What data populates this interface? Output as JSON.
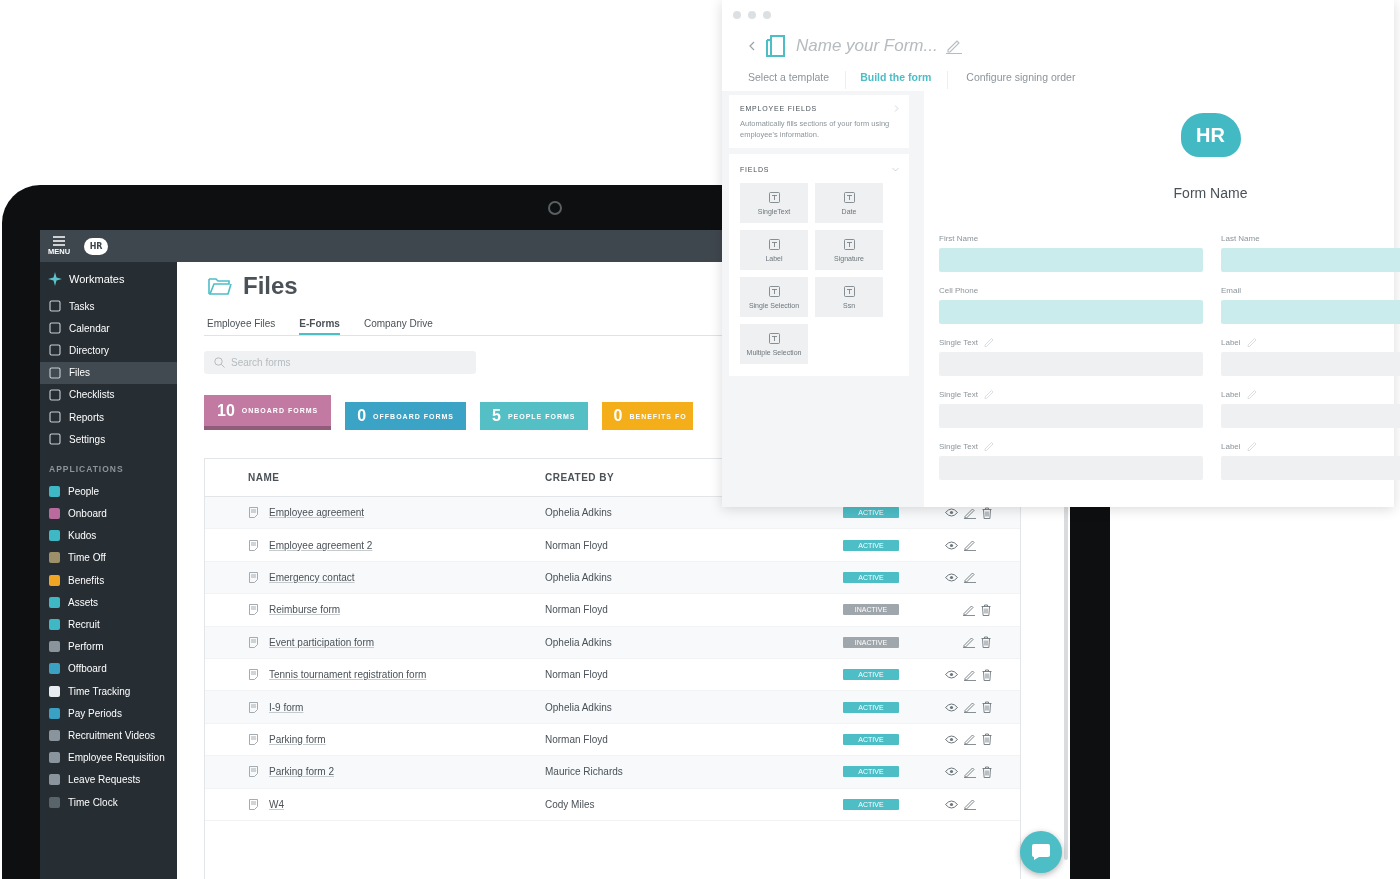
{
  "app": {
    "menu_label": "MENU",
    "logo": "HR"
  },
  "sidebar": {
    "brand": "Workmates",
    "items": [
      {
        "label": "Tasks",
        "selected": false
      },
      {
        "label": "Calendar",
        "selected": false
      },
      {
        "label": "Directory",
        "selected": false
      },
      {
        "label": "Files",
        "selected": true
      },
      {
        "label": "Checklists",
        "selected": false
      },
      {
        "label": "Reports",
        "selected": false
      },
      {
        "label": "Settings",
        "selected": false
      }
    ],
    "section": "APPLICATIONS",
    "apps": [
      {
        "label": "People",
        "color": "#3fb8c6"
      },
      {
        "label": "Onboard",
        "color": "#b86b9c"
      },
      {
        "label": "Kudos",
        "color": "#3fb8c6"
      },
      {
        "label": "Time Off",
        "color": "#9c8f6a"
      },
      {
        "label": "Benefits",
        "color": "#f0a623"
      },
      {
        "label": "Assets",
        "color": "#3fb8c6"
      },
      {
        "label": "Recruit",
        "color": "#3fb8c6"
      },
      {
        "label": "Perform",
        "color": "#8a949c"
      },
      {
        "label": "Offboard",
        "color": "#3aa0c4"
      },
      {
        "label": "Time Tracking",
        "color": "#e8eef0"
      },
      {
        "label": "Pay Periods",
        "color": "#3aa0c4"
      },
      {
        "label": "Recruitment Videos",
        "color": "#8a949c"
      },
      {
        "label": "Employee Requisition",
        "color": "#8a949c"
      },
      {
        "label": "Leave Requests",
        "color": "#8a949c"
      },
      {
        "label": "Time Clock",
        "color": "#59636a"
      }
    ]
  },
  "page": {
    "title": "Files",
    "tabs": [
      {
        "label": "Employee Files",
        "selected": false
      },
      {
        "label": "E-Forms",
        "selected": true
      },
      {
        "label": "Company Drive",
        "selected": false
      }
    ],
    "search": {
      "placeholder": "Search forms"
    },
    "cards": [
      {
        "count": "10",
        "label": "ONBOARD FORMS",
        "color": "#c27aa3",
        "selected": true
      },
      {
        "count": "0",
        "label": "OFFBOARD FORMS",
        "color": "#3aa3c6",
        "selected": false
      },
      {
        "count": "5",
        "label": "PEOPLE FORMS",
        "color": "#55bfc6",
        "selected": false
      },
      {
        "count": "0",
        "label": "BENEFITS FO",
        "color": "#f3ae19",
        "selected": false
      }
    ],
    "table": {
      "columns": [
        "NAME",
        "CREATED BY"
      ],
      "rows": [
        {
          "name": "Employee agreement",
          "created_by": "Ophelia Adkins",
          "status": "ACTIVE",
          "active": true,
          "view": true,
          "delete": true
        },
        {
          "name": "Employee agreement 2",
          "created_by": "Norman Floyd",
          "status": "ACTIVE",
          "active": true,
          "view": true,
          "delete": false
        },
        {
          "name": "Emergency contact",
          "created_by": "Ophelia Adkins",
          "status": "ACTIVE",
          "active": true,
          "view": true,
          "delete": false
        },
        {
          "name": "Reimburse form",
          "created_by": "Norman Floyd",
          "status": "INACTIVE",
          "active": false,
          "view": false,
          "delete": true
        },
        {
          "name": "Event participation form",
          "created_by": "Ophelia Adkins",
          "status": "INACTIVE",
          "active": false,
          "view": false,
          "delete": true
        },
        {
          "name": "Tennis tournament registration form",
          "created_by": "Norman Floyd",
          "status": "ACTIVE",
          "active": true,
          "view": true,
          "delete": true
        },
        {
          "name": "I-9 form",
          "created_by": "Ophelia Adkins",
          "status": "ACTIVE",
          "active": true,
          "view": true,
          "delete": true
        },
        {
          "name": "Parking form",
          "created_by": "Norman Floyd",
          "status": "ACTIVE",
          "active": true,
          "view": true,
          "delete": true
        },
        {
          "name": "Parking form 2",
          "created_by": "Maurice Richards",
          "status": "ACTIVE",
          "active": true,
          "view": true,
          "delete": true
        },
        {
          "name": "W4",
          "created_by": "Cody Miles",
          "status": "ACTIVE",
          "active": true,
          "view": true,
          "delete": false
        }
      ]
    }
  },
  "builder": {
    "title": {
      "placeholder": "Name your Form..."
    },
    "steps": [
      {
        "label": "Select a template",
        "selected": false
      },
      {
        "label": "Build the form",
        "selected": true
      },
      {
        "label": "Configure signing order",
        "selected": false
      }
    ],
    "employee_fields": {
      "title": "EMPLOYEE FIELDS",
      "description": "Automatically fills sections of your form using employee's information."
    },
    "fields": {
      "title": "FIELDS",
      "items": [
        "SingleText",
        "Date",
        "Label",
        "Signature",
        "Single Selection",
        "Ssn",
        "Multiple Selection"
      ]
    },
    "form": {
      "logo": "HR",
      "name": "Form Name",
      "fields": [
        {
          "label": "First Name",
          "kind": "employee"
        },
        {
          "label": "Last Name",
          "kind": "employee"
        },
        {
          "label": "Cell Phone",
          "kind": "employee"
        },
        {
          "label": "Email",
          "kind": "employee"
        },
        {
          "label": "Single Text",
          "kind": "custom"
        },
        {
          "label": "Label",
          "kind": "custom"
        },
        {
          "label": "Single Text",
          "kind": "custom"
        },
        {
          "label": "Label",
          "kind": "custom"
        },
        {
          "label": "Single Text",
          "kind": "custom"
        },
        {
          "label": "Label",
          "kind": "custom"
        }
      ]
    }
  }
}
